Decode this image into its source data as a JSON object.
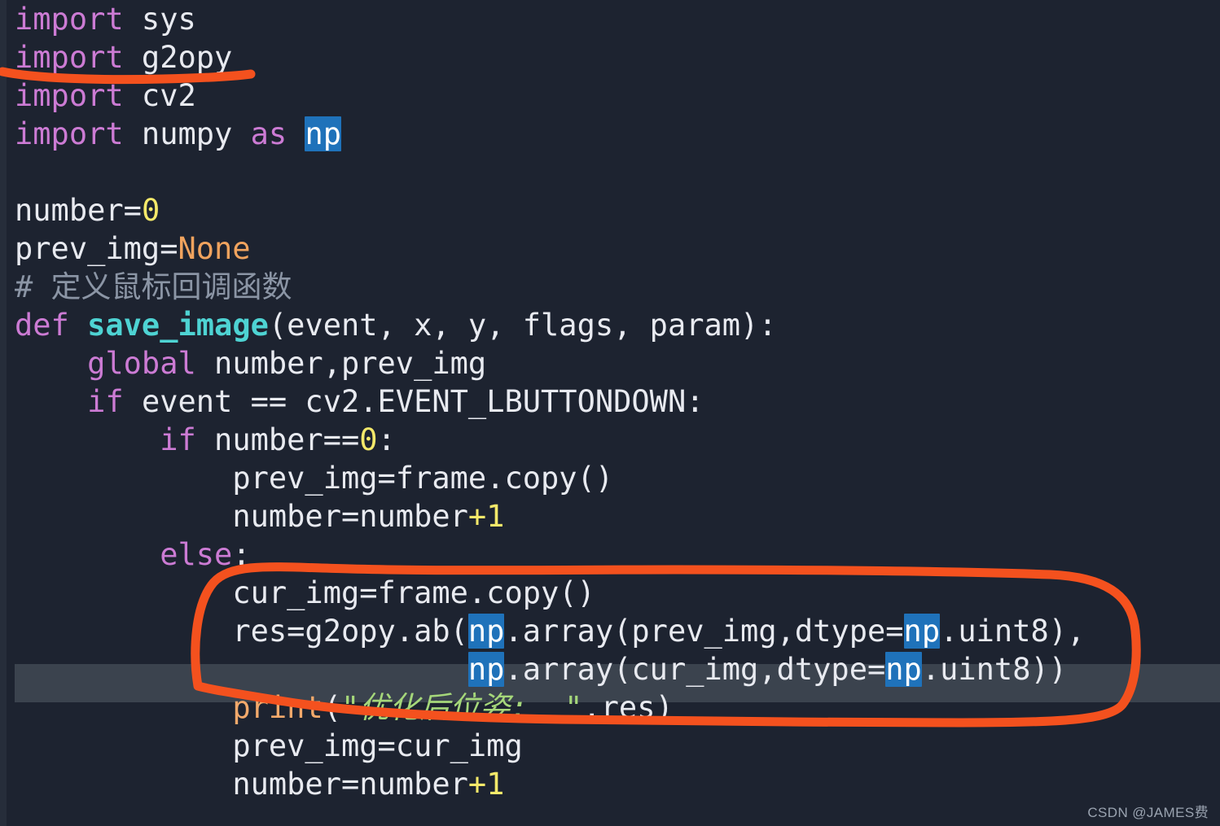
{
  "window": {
    "kind": "code-editor",
    "theme": "dark",
    "background_color": "#1d2330",
    "current_line_highlight_color": "#3b434e",
    "selection_highlight_color": "#1f72ba"
  },
  "annotations": {
    "color": "#f4511e",
    "marks": [
      {
        "type": "underline",
        "target": "import g2opy",
        "note": "red/orange underline beneath the g2opy import statement"
      },
      {
        "type": "ellipse",
        "target": "res=g2opy.ab(np.array(prev_img,dtype=np.uint8), np.array(cur_img,dtype=np.uint8))",
        "note": "hand-drawn orange circle around the g2opy.ab call block"
      }
    ]
  },
  "watermark": {
    "text": "CSDN @JAMES费"
  },
  "code": {
    "language": "python",
    "selected_token": "np",
    "current_line_number": 18,
    "lines": [
      {
        "n": 1,
        "indent": 0,
        "tokens": [
          {
            "t": "import",
            "c": "kw"
          },
          {
            "t": " sys",
            "c": "plain"
          }
        ]
      },
      {
        "n": 2,
        "indent": 0,
        "tokens": [
          {
            "t": "import",
            "c": "kw"
          },
          {
            "t": " g2opy",
            "c": "plain"
          }
        ]
      },
      {
        "n": 3,
        "indent": 0,
        "tokens": [
          {
            "t": "import",
            "c": "kw"
          },
          {
            "t": " cv2",
            "c": "plain"
          }
        ]
      },
      {
        "n": 4,
        "indent": 0,
        "tokens": [
          {
            "t": "import",
            "c": "kw"
          },
          {
            "t": " numpy ",
            "c": "plain"
          },
          {
            "t": "as",
            "c": "kw"
          },
          {
            "t": " ",
            "c": "plain"
          },
          {
            "t": "np",
            "c": "sel"
          }
        ]
      },
      {
        "n": 5,
        "indent": 0,
        "tokens": []
      },
      {
        "n": 6,
        "indent": 0,
        "tokens": [
          {
            "t": "number=",
            "c": "plain"
          },
          {
            "t": "0",
            "c": "num"
          }
        ]
      },
      {
        "n": 7,
        "indent": 0,
        "tokens": [
          {
            "t": "prev_img=",
            "c": "plain"
          },
          {
            "t": "None",
            "c": "const"
          }
        ]
      },
      {
        "n": 8,
        "indent": 0,
        "tokens": [
          {
            "t": "# 定义鼠标回调函数",
            "c": "comment"
          }
        ]
      },
      {
        "n": 9,
        "indent": 0,
        "tokens": [
          {
            "t": "def",
            "c": "kw"
          },
          {
            "t": " ",
            "c": "plain"
          },
          {
            "t": "save_image",
            "c": "fn"
          },
          {
            "t": "(event, x, y, flags, param):",
            "c": "plain"
          }
        ]
      },
      {
        "n": 10,
        "indent": 1,
        "tokens": [
          {
            "t": "global",
            "c": "kw"
          },
          {
            "t": " number,prev_img",
            "c": "plain"
          }
        ]
      },
      {
        "n": 11,
        "indent": 1,
        "tokens": [
          {
            "t": "if",
            "c": "kw"
          },
          {
            "t": " event == cv2.EVENT_LBUTTONDOWN:",
            "c": "plain"
          }
        ]
      },
      {
        "n": 12,
        "indent": 2,
        "tokens": [
          {
            "t": "if",
            "c": "kw"
          },
          {
            "t": " number==",
            "c": "plain"
          },
          {
            "t": "0",
            "c": "num"
          },
          {
            "t": ":",
            "c": "plain"
          }
        ]
      },
      {
        "n": 13,
        "indent": 3,
        "tokens": [
          {
            "t": "prev_img=frame.copy()",
            "c": "plain"
          }
        ]
      },
      {
        "n": 14,
        "indent": 3,
        "tokens": [
          {
            "t": "number=number",
            "c": "plain"
          },
          {
            "t": "+1",
            "c": "num"
          }
        ]
      },
      {
        "n": 15,
        "indent": 2,
        "tokens": [
          {
            "t": "else",
            "c": "kw"
          },
          {
            "t": ":",
            "c": "plain"
          }
        ]
      },
      {
        "n": 16,
        "indent": 3,
        "tokens": [
          {
            "t": "cur_img=frame.copy()",
            "c": "plain"
          }
        ]
      },
      {
        "n": 17,
        "indent": 3,
        "tokens": [
          {
            "t": "res=g2opy.ab(",
            "c": "plain"
          },
          {
            "t": "np",
            "c": "sel"
          },
          {
            "t": ".array(prev_img,dtype=",
            "c": "plain"
          },
          {
            "t": "np",
            "c": "sel"
          },
          {
            "t": ".uint8),",
            "c": "plain"
          }
        ]
      },
      {
        "n": 18,
        "indent": 3,
        "current": true,
        "tokens": [
          {
            "t": "             ",
            "c": "plain"
          },
          {
            "t": "np",
            "c": "sel"
          },
          {
            "t": ".array(cur_img,dtype=",
            "c": "plain"
          },
          {
            "t": "np",
            "c": "sel"
          },
          {
            "t": ".uint8))",
            "c": "plain"
          }
        ]
      },
      {
        "n": 19,
        "indent": 3,
        "tokens": [
          {
            "t": "print",
            "c": "builtin"
          },
          {
            "t": "(",
            "c": "plain"
          },
          {
            "t": "\"",
            "c": "str"
          },
          {
            "t": "优化后位姿:  ",
            "c": "str"
          },
          {
            "t": "\"",
            "c": "str"
          },
          {
            "t": ",res)",
            "c": "plain"
          }
        ]
      },
      {
        "n": 20,
        "indent": 3,
        "tokens": [
          {
            "t": "prev_img=cur_img",
            "c": "plain"
          }
        ]
      },
      {
        "n": 21,
        "indent": 3,
        "tokens": [
          {
            "t": "number=number",
            "c": "plain"
          },
          {
            "t": "+1",
            "c": "num"
          }
        ]
      }
    ]
  }
}
